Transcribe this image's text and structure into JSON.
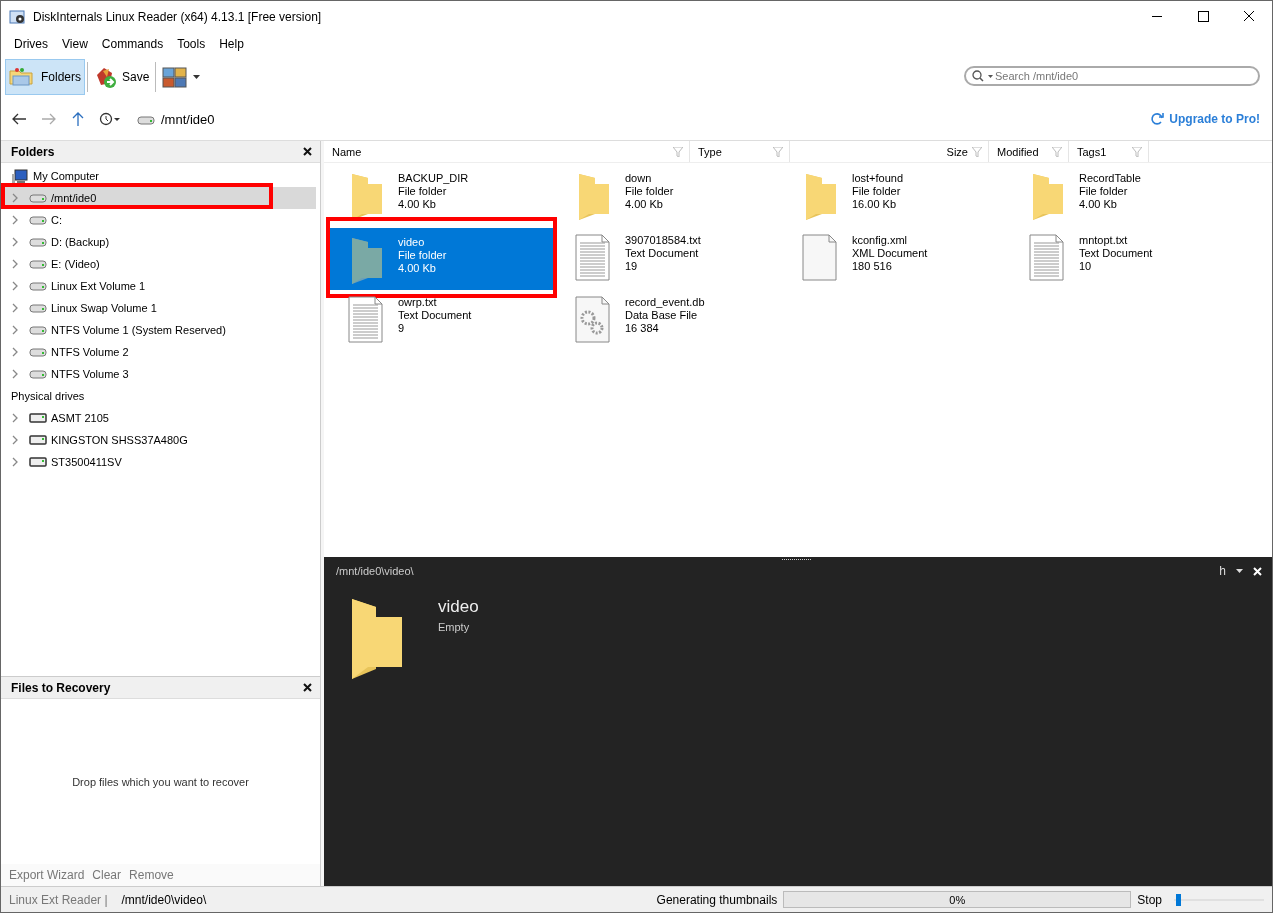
{
  "window": {
    "title": "DiskInternals Linux Reader (x64) 4.13.1 [Free version]"
  },
  "menu": [
    "Drives",
    "View",
    "Commands",
    "Tools",
    "Help"
  ],
  "toolbar": {
    "buttons": [
      {
        "label": "Folders",
        "kind": "folders",
        "selected": true
      },
      {
        "label": "Save",
        "kind": "save",
        "selected": false
      },
      {
        "kind": "view",
        "selected": false
      }
    ],
    "search": {
      "placeholder": "Search /mnt/ide0"
    }
  },
  "nav": {
    "back_disabled": false,
    "forward_disabled": true,
    "path": "/mnt/ide0",
    "upgrade": "Upgrade to Pro!"
  },
  "folders_panel": {
    "title": "Folders",
    "groups": [
      {
        "label": "My Computer",
        "kind": "computer",
        "children": [
          {
            "label": "/mnt/ide0",
            "kind": "volume",
            "expanded": false,
            "selected": true,
            "highlighted": true
          },
          {
            "label": "C:",
            "kind": "volume",
            "expanded": false,
            "selected": false,
            "highlighted": false
          },
          {
            "label": "D: (Backup)",
            "kind": "volume",
            "expanded": false,
            "selected": false,
            "highlighted": false
          },
          {
            "label": "E: (Video)",
            "kind": "volume",
            "expanded": false,
            "selected": false,
            "highlighted": false
          },
          {
            "label": "Linux Ext Volume 1",
            "kind": "volume",
            "expanded": false,
            "selected": false,
            "highlighted": false
          },
          {
            "label": "Linux Swap Volume 1",
            "kind": "volume",
            "expanded": false,
            "selected": false,
            "highlighted": false
          },
          {
            "label": "NTFS Volume 1 (System Reserved)",
            "kind": "volume",
            "expanded": false,
            "selected": false,
            "highlighted": false
          },
          {
            "label": "NTFS Volume 2",
            "kind": "volume",
            "expanded": false,
            "selected": false,
            "highlighted": false
          },
          {
            "label": "NTFS Volume 3",
            "kind": "volume",
            "expanded": false,
            "selected": false,
            "highlighted": false
          }
        ]
      },
      {
        "label": "Physical drives",
        "kind": "header",
        "children": [
          {
            "label": "ASMT 2105",
            "kind": "disk",
            "expanded": false,
            "selected": false,
            "highlighted": false
          },
          {
            "label": "KINGSTON SHSS37A480G",
            "kind": "disk",
            "expanded": false,
            "selected": false,
            "highlighted": false
          },
          {
            "label": "ST3500411SV",
            "kind": "disk",
            "expanded": false,
            "selected": false,
            "highlighted": false
          }
        ]
      }
    ]
  },
  "recovery_panel": {
    "title": "Files to Recovery",
    "hint": "Drop files which you want to recover",
    "actions": [
      "Export Wizard",
      "Clear",
      "Remove"
    ]
  },
  "file_list": {
    "columns": [
      {
        "label": "Name",
        "kind": "name"
      },
      {
        "label": "Type",
        "kind": "type"
      },
      {
        "kind": "spacer"
      },
      {
        "label": "Size",
        "kind": "size"
      },
      {
        "label": "Modified",
        "kind": "modified"
      },
      {
        "label": "Tags1",
        "kind": "tags"
      }
    ],
    "items": [
      {
        "name": "BACKUP_DIR",
        "type": "File folder",
        "size": "4.00 Kb",
        "kind": "folder",
        "selected": false,
        "highlighted": false
      },
      {
        "name": "down",
        "type": "File folder",
        "size": "4.00 Kb",
        "kind": "folder",
        "selected": false,
        "highlighted": false
      },
      {
        "name": "lost+found",
        "type": "File folder",
        "size": "16.00 Kb",
        "kind": "folder",
        "selected": false,
        "highlighted": false
      },
      {
        "name": "RecordTable",
        "type": "File folder",
        "size": "4.00 Kb",
        "kind": "folder",
        "selected": false,
        "highlighted": false
      },
      {
        "name": "video",
        "type": "File folder",
        "size": "4.00 Kb",
        "kind": "folder",
        "selected": true,
        "highlighted": true
      },
      {
        "name": "3907018584.txt",
        "type": "Text Document",
        "size": "19",
        "kind": "text",
        "selected": false,
        "highlighted": false
      },
      {
        "name": "kconfig.xml",
        "type": "XML Document",
        "size": "180 516",
        "kind": "blank",
        "selected": false,
        "highlighted": false
      },
      {
        "name": "mntopt.txt",
        "type": "Text Document",
        "size": "10",
        "kind": "text",
        "selected": false,
        "highlighted": false
      },
      {
        "name": "owrp.txt",
        "type": "Text Document",
        "size": "9",
        "kind": "text",
        "selected": false,
        "highlighted": false
      },
      {
        "name": "record_event.db",
        "type": "Data Base File",
        "size": "16 384",
        "kind": "db",
        "selected": false,
        "highlighted": false
      }
    ]
  },
  "preview": {
    "path": "/mnt/ide0\\video\\",
    "name": "video",
    "detail": "Empty",
    "mode": "h"
  },
  "status_bar": {
    "app": "Linux Ext Reader |",
    "path": "/mnt/ide0\\video\\",
    "task": "Generating thumbnails",
    "progress": {
      "level": 0,
      "reading": "0%"
    },
    "stop": "Stop",
    "zoom": {
      "level": 0.02
    }
  }
}
